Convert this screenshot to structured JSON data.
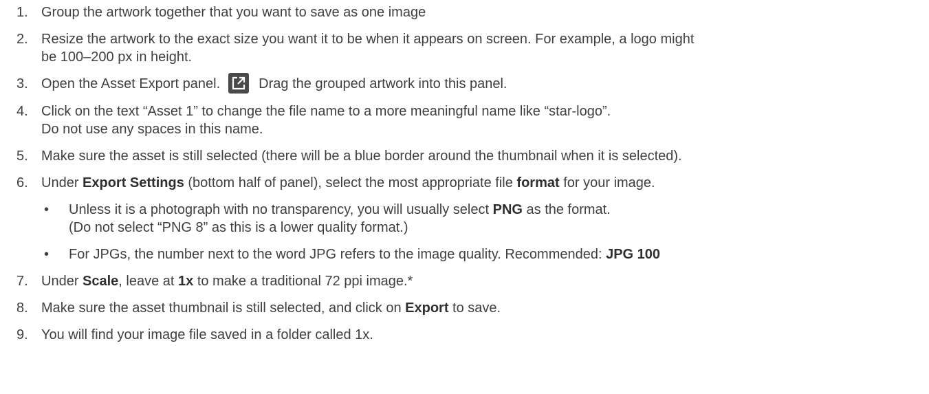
{
  "steps": [
    {
      "num": "1.",
      "text": "Group the artwork together that you want to save as one image"
    },
    {
      "num": "2.",
      "line1": "Resize the artwork to the exact size you want it to be when it appears on screen. For example, a logo might",
      "line2": "be 100–200 px in height."
    },
    {
      "num": "3.",
      "before": "Open the Asset Export panel.",
      "after": "Drag the grouped artwork into this panel.",
      "icon": "export-icon"
    },
    {
      "num": "4.",
      "line1": "Click on the text “Asset 1” to change the file name to a more meaningful name like “star-logo”.",
      "line2": "Do not use any spaces  in this name."
    },
    {
      "num": "5.",
      "text": "Make sure the asset is still selected (there will be a blue border around the thumbnail when it is selected)."
    },
    {
      "num": "6.",
      "p1": "Under ",
      "b1": "Export Settings",
      "p2": " (bottom half of panel), select the most appropriate file ",
      "b2": "format",
      "p3": " for your image."
    },
    {
      "num": "7.",
      "p1": "Under ",
      "b1": "Scale",
      "p2": ", leave at ",
      "b2": "1x",
      "p3": " to make a traditional 72 ppi image.*"
    },
    {
      "num": "8.",
      "p1": "Make sure the asset thumbnail is still selected, and click on ",
      "b1": "Export",
      "p2": " to save."
    },
    {
      "num": "9.",
      "text": "You will find your image file saved in a folder called 1x."
    }
  ],
  "bullets": [
    {
      "dot": "•",
      "p1": "Unless it is a photograph with no transparency, you will usually select ",
      "b1": "PNG",
      "p2": " as the format.",
      "line2": "(Do not select “PNG 8” as this is a lower quality format.)"
    },
    {
      "dot": "•",
      "p1": "For JPGs, the number next to the word JPG refers to the image quality. Recommended: ",
      "b1": "JPG 100"
    }
  ]
}
